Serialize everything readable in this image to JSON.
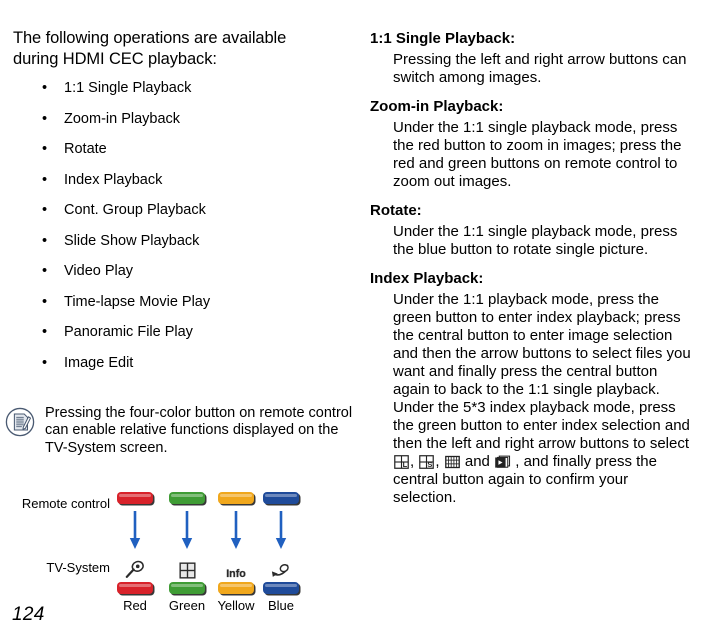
{
  "left": {
    "intro": "The following operations are available during HDMI CEC playback:",
    "bullet_char": "•",
    "features": [
      "1:1 Single Playback",
      "Zoom-in Playback",
      "Rotate",
      "Index Playback",
      "Cont. Group Playback",
      "Slide Show Playback",
      "Video Play",
      "Time-lapse Movie Play",
      "Panoramic File Play",
      "Image Edit"
    ],
    "note": {
      "icon": "note-document-pencil-icon",
      "text": "Pressing the four-color button on remote control can enable relative functions displayed on the TV-System screen."
    },
    "diagram": {
      "remote_label": "Remote control",
      "tv_label": "TV-System",
      "buttons": [
        {
          "caption": "Red",
          "color": "#d8222a",
          "tv_icon": "magnifier-zoom-icon"
        },
        {
          "caption": "Green",
          "color": "#3f9c35",
          "tv_icon": "grid-index-icon"
        },
        {
          "caption": "Yellow",
          "color": "#f0a71c",
          "tv_icon": "info-icon"
        },
        {
          "caption": "Blue",
          "color": "#1f4b9a",
          "tv_icon": "rotate-arrow-icon"
        }
      ],
      "arrow_color": "#2060c0"
    },
    "page_number": "124"
  },
  "right": {
    "sections": [
      {
        "heading": "1:1 Single Playback:",
        "lines": [
          "Pressing the left and right arrow buttons can switch among images."
        ]
      },
      {
        "heading": "Zoom-in Playback:",
        "lines": [
          "Under the 1:1 single playback mode, press the red button to zoom in images; press the red and green buttons on remote control to zoom out images."
        ]
      },
      {
        "heading": "Rotate:",
        "lines": [
          "Under the 1:1 single playback mode, press the blue button to rotate single picture."
        ]
      },
      {
        "heading": "Index Playback:",
        "lines": [
          "Under the 1:1 playback mode, press the green button to enter index playback; press the central button to enter image selection and then the arrow buttons to select files you want and finally press the central button again to back to the 1:1 single playback.",
          "Under the 5*3 index playback mode, press the green button to enter index selection and then the left and right arrow buttons to select "
        ],
        "index_icons": [
          "layout-L-grid-icon",
          "layout-S-grid-icon",
          "grid-5x3-icon",
          "video-stack-play-icon"
        ],
        "tail_separator_1": ", ",
        "tail_separator_2": ", ",
        "tail_and": " and ",
        "tail_text": " , and finally press the central button again to confirm your selection."
      }
    ]
  }
}
